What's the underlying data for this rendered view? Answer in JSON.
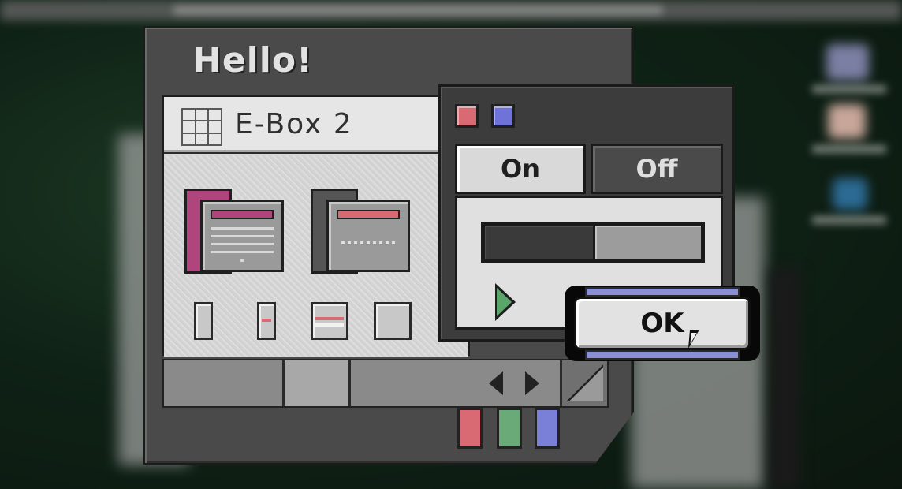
{
  "window": {
    "title": "Hello!",
    "box_label": "E-Box 2"
  },
  "panel": {
    "toggle_on_label": "On",
    "toggle_off_label": "Off",
    "selected_toggle": "Off",
    "slider_value": 0.5,
    "ok_label": "OK"
  },
  "colors": {
    "red": "#d96a74",
    "blue": "#7a7fd8",
    "green": "#6aaa78",
    "magenta": "#b0457e",
    "window_dark": "#4a4a4a",
    "panel_light": "#e0e0e0"
  },
  "icons": [
    "grid-icon",
    "magenta-folder-icon",
    "gray-folder-icon",
    "vertical-bar-icon",
    "red-stripe-bar-icon",
    "striped-block-icon",
    "square-block-icon",
    "arrow-left-icon",
    "arrow-right-icon",
    "resize-icon",
    "play-icon",
    "cursor-icon"
  ]
}
